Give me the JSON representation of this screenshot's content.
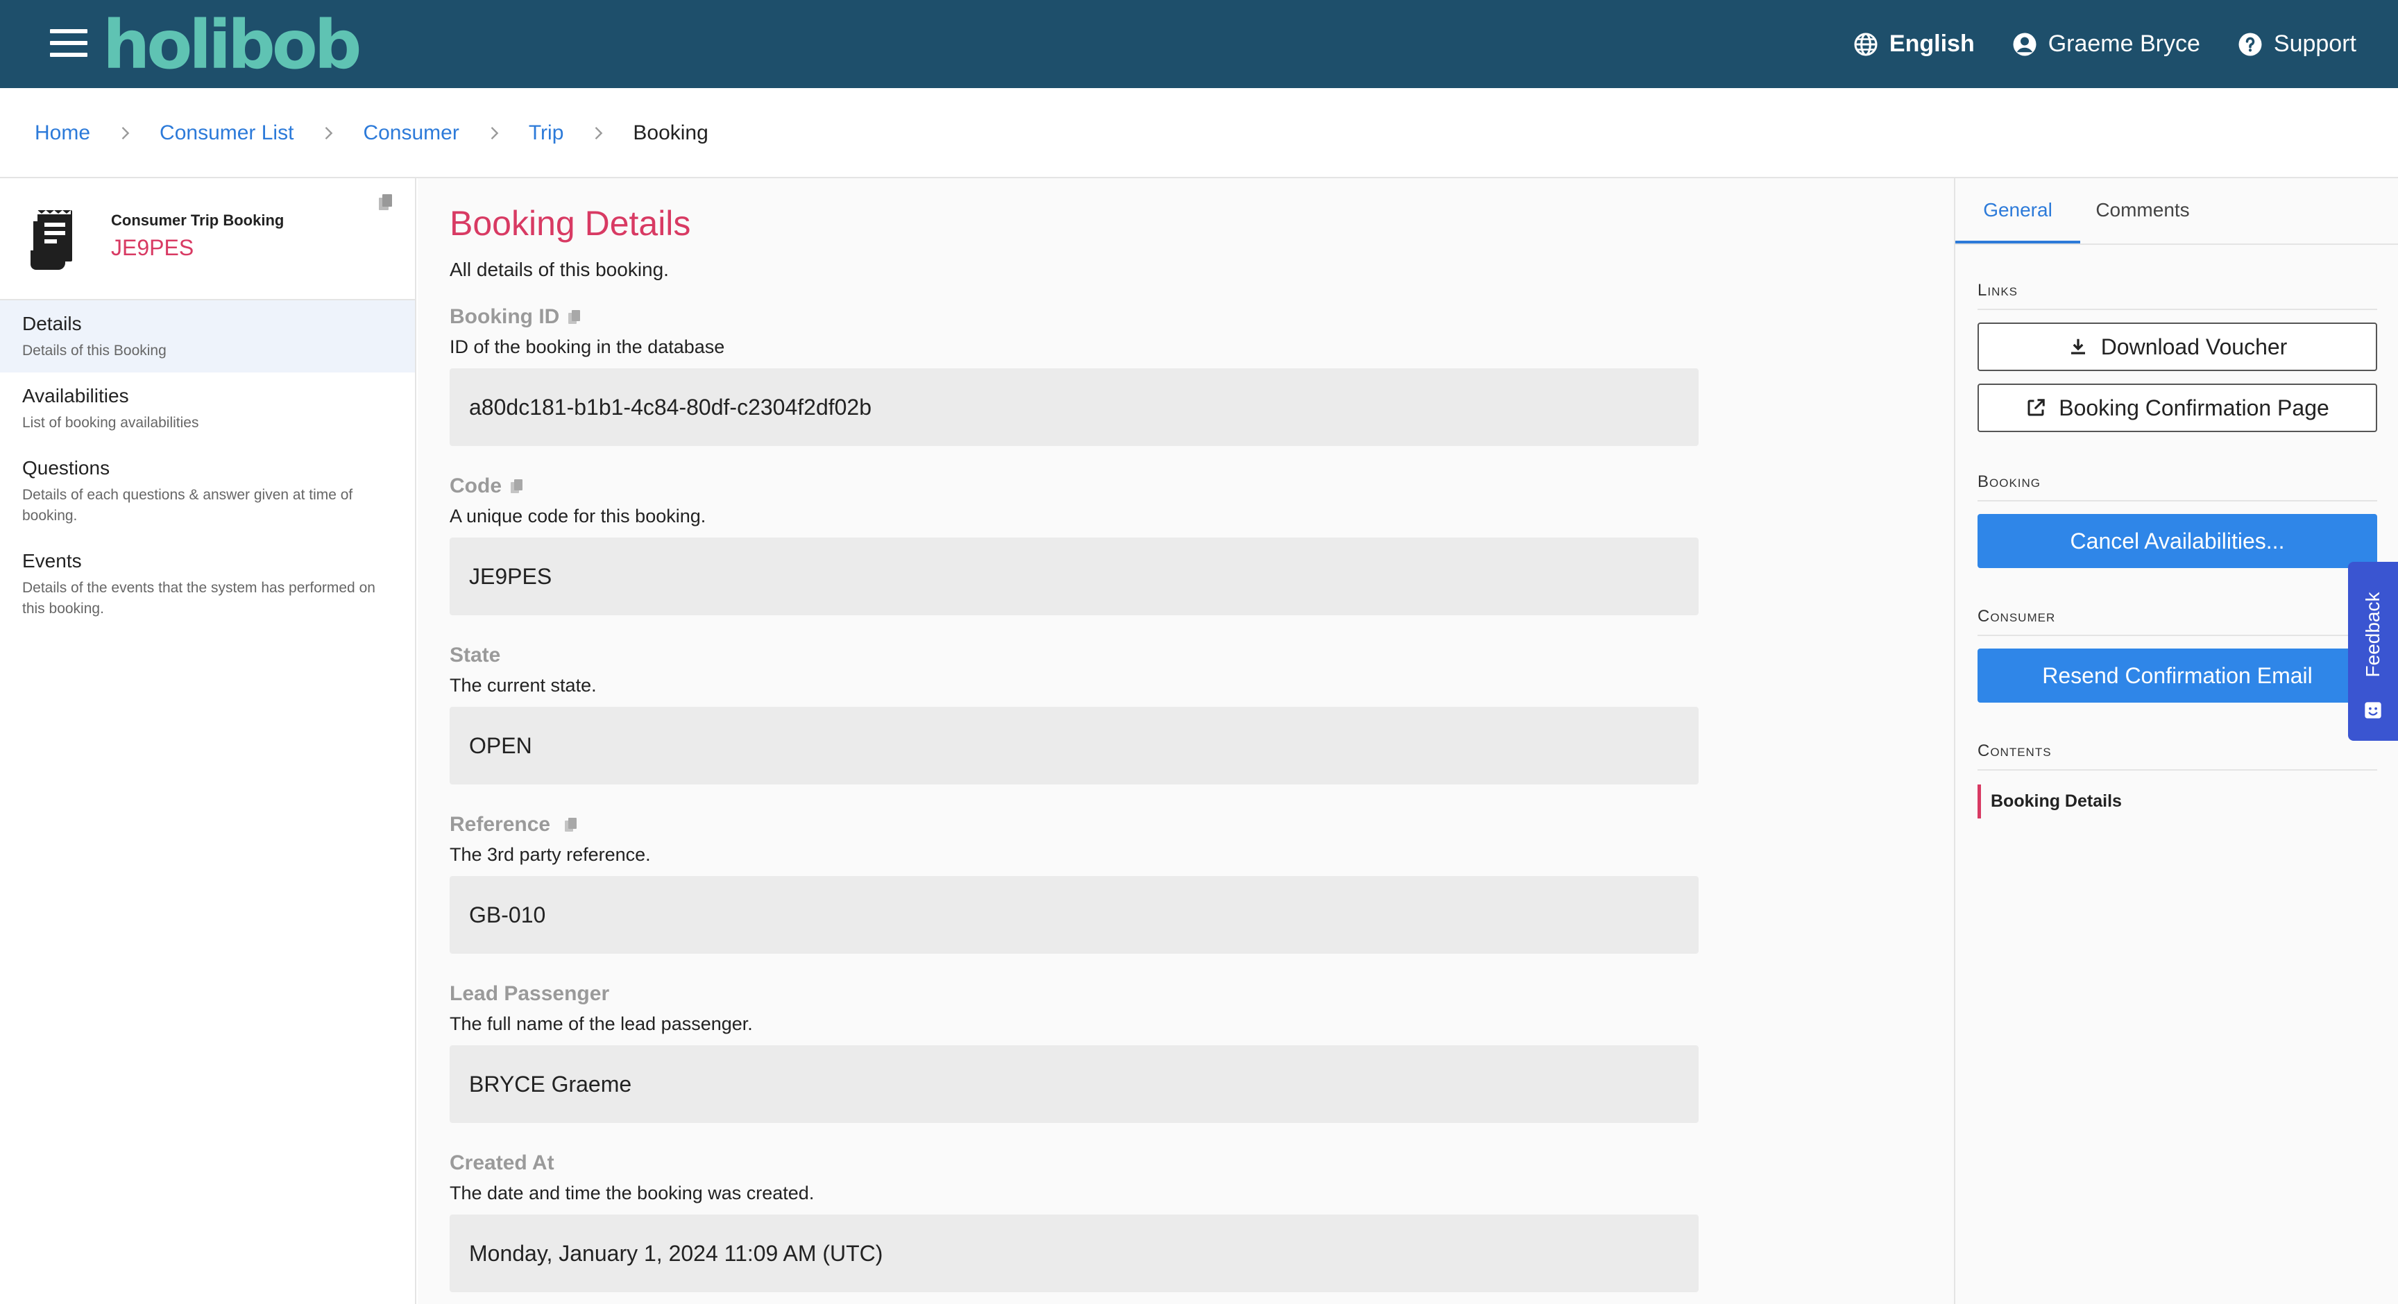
{
  "app": {
    "brand": "holibob",
    "colors": {
      "header_bg": "#1e4f6b",
      "logo": "#5fc3b3",
      "accent": "#2c7ad9",
      "primary_button": "#2f86e8",
      "highlight": "#d83a63",
      "feedback": "#3a55d1"
    }
  },
  "topnav": {
    "language": "English",
    "user": "Graeme Bryce",
    "support": "Support",
    "icons": {
      "menu": "hamburger-icon",
      "language": "globe-icon",
      "user": "user-circle-icon",
      "support": "help-circle-icon"
    }
  },
  "breadcrumb": {
    "items": [
      "Home",
      "Consumer List",
      "Consumer",
      "Trip"
    ],
    "current": "Booking"
  },
  "sidebar": {
    "header": {
      "type": "Consumer Trip Booking",
      "code": "JE9PES"
    },
    "items": [
      {
        "title": "Details",
        "desc": "Details of this Booking",
        "active": true
      },
      {
        "title": "Availabilities",
        "desc": "List of booking availabilities"
      },
      {
        "title": "Questions",
        "desc": "Details of each questions & answer given at time of booking."
      },
      {
        "title": "Events",
        "desc": "Details of the events that the system has performed on this booking."
      }
    ]
  },
  "main": {
    "title": "Booking Details",
    "intro": "All details of this booking.",
    "fields": [
      {
        "label": "Booking ID",
        "desc": "ID of the booking in the database",
        "value": "a80dc181-b1b1-4c84-80df-c2304f2df02b",
        "copyable": true
      },
      {
        "label": "Code",
        "desc": "A unique code for this booking.",
        "value": "JE9PES",
        "copyable": true
      },
      {
        "label": "State",
        "desc": "The current state.",
        "value": "OPEN",
        "copyable": false
      },
      {
        "label": "Reference",
        "desc": "The 3rd party reference.",
        "value": "GB-010",
        "copyable": true
      },
      {
        "label": "Lead Passenger",
        "desc": "The full name of the lead passenger.",
        "value": "BRYCE Graeme",
        "copyable": false
      },
      {
        "label": "Created At",
        "desc": "The date and time the booking was created.",
        "value": "Monday, January 1, 2024 11:09 AM (UTC)",
        "copyable": false
      }
    ]
  },
  "rpanel": {
    "tabs": [
      "General",
      "Comments"
    ],
    "active_tab": "General",
    "links": {
      "heading": "Links",
      "download_voucher": "Download Voucher",
      "confirmation_page": "Booking Confirmation Page"
    },
    "booking": {
      "heading": "Booking",
      "cancel": "Cancel Availabilities..."
    },
    "consumer": {
      "heading": "Consumer",
      "resend": "Resend Confirmation Email"
    },
    "contents": {
      "heading": "Contents",
      "items": [
        "Booking Details"
      ]
    }
  },
  "feedback": {
    "label": "Feedback"
  }
}
